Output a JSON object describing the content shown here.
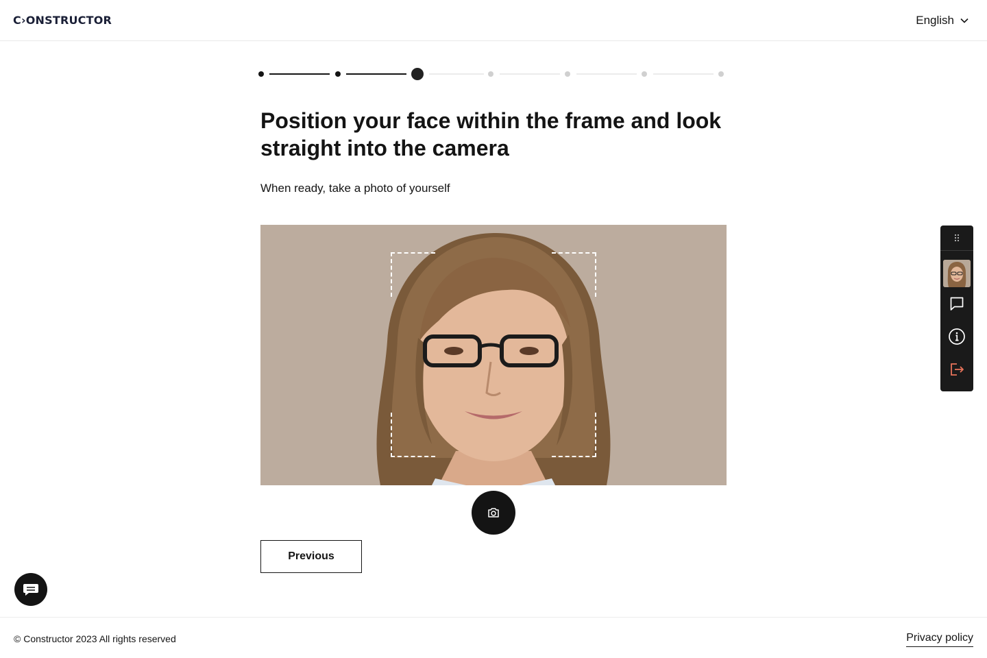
{
  "header": {
    "logo": "C›ONSTRUCTOR",
    "language": "English",
    "language_icon": "chevron-down-icon"
  },
  "stepper": {
    "total_steps": 7,
    "current_step": 3,
    "colors": {
      "done": "#141414",
      "pending": "#d0d0d0"
    }
  },
  "main": {
    "title": "Position your face within the frame and look straight into the camera",
    "subtitle": "When ready, take a photo of yourself",
    "shutter_icon": "camera-icon",
    "previous_label": "Previous"
  },
  "toolbar": {
    "items": [
      "drag-handle-icon",
      "avatar",
      "chat-icon",
      "info-icon",
      "logout-icon"
    ],
    "logout_color": "#e8735a"
  },
  "chat_widget_icon": "chat-bubble-icon",
  "footer": {
    "copyright": "© Constructor 2023 All rights reserved",
    "privacy": "Privacy policy"
  }
}
